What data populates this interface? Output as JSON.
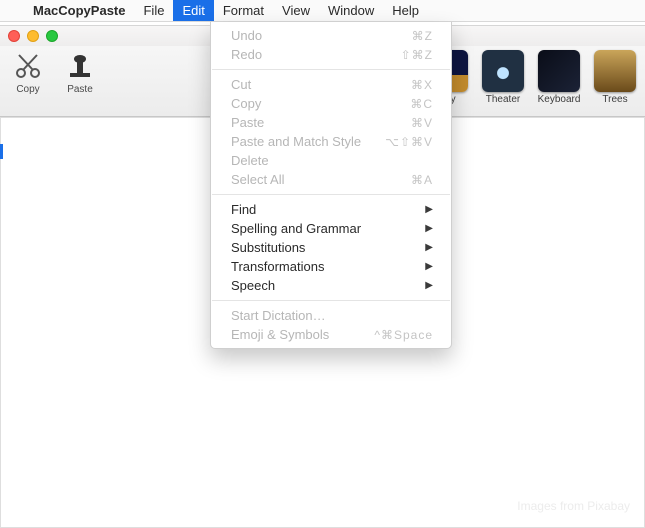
{
  "menubar": {
    "app": "MacCopyPaste",
    "items": [
      "File",
      "Edit",
      "Format",
      "View",
      "Window",
      "Help"
    ],
    "selected": "Edit"
  },
  "toolbar": {
    "left": [
      {
        "name": "copy-button",
        "icon": "scissors",
        "label": "Copy"
      },
      {
        "name": "paste-button",
        "icon": "stamp",
        "label": "Paste"
      }
    ],
    "thumbs": [
      {
        "name": "thumb-city",
        "label": "City",
        "cls": "city"
      },
      {
        "name": "thumb-theater",
        "label": "Theater",
        "cls": "theater"
      },
      {
        "name": "thumb-keyboard",
        "label": "Keyboard",
        "cls": "keyboard"
      },
      {
        "name": "thumb-trees",
        "label": "Trees",
        "cls": "trees"
      }
    ]
  },
  "dropdown": {
    "groups": [
      [
        {
          "label": "Undo",
          "shortcut": "⌘Z",
          "enabled": false
        },
        {
          "label": "Redo",
          "shortcut": "⇧⌘Z",
          "enabled": false
        }
      ],
      [
        {
          "label": "Cut",
          "shortcut": "⌘X",
          "enabled": false
        },
        {
          "label": "Copy",
          "shortcut": "⌘C",
          "enabled": false
        },
        {
          "label": "Paste",
          "shortcut": "⌘V",
          "enabled": false
        },
        {
          "label": "Paste and Match Style",
          "shortcut": "⌥⇧⌘V",
          "enabled": false
        },
        {
          "label": "Delete",
          "shortcut": "",
          "enabled": false
        },
        {
          "label": "Select All",
          "shortcut": "⌘A",
          "enabled": false
        }
      ],
      [
        {
          "label": "Find",
          "submenu": true,
          "enabled": true
        },
        {
          "label": "Spelling and Grammar",
          "submenu": true,
          "enabled": true
        },
        {
          "label": "Substitutions",
          "submenu": true,
          "enabled": true
        },
        {
          "label": "Transformations",
          "submenu": true,
          "enabled": true
        },
        {
          "label": "Speech",
          "submenu": true,
          "enabled": true
        }
      ],
      [
        {
          "label": "Start Dictation…",
          "shortcut": "",
          "enabled": false
        },
        {
          "label": "Emoji & Symbols",
          "shortcut": "^⌘Space",
          "enabled": false
        }
      ]
    ]
  },
  "credit": "Images from Pixabay"
}
